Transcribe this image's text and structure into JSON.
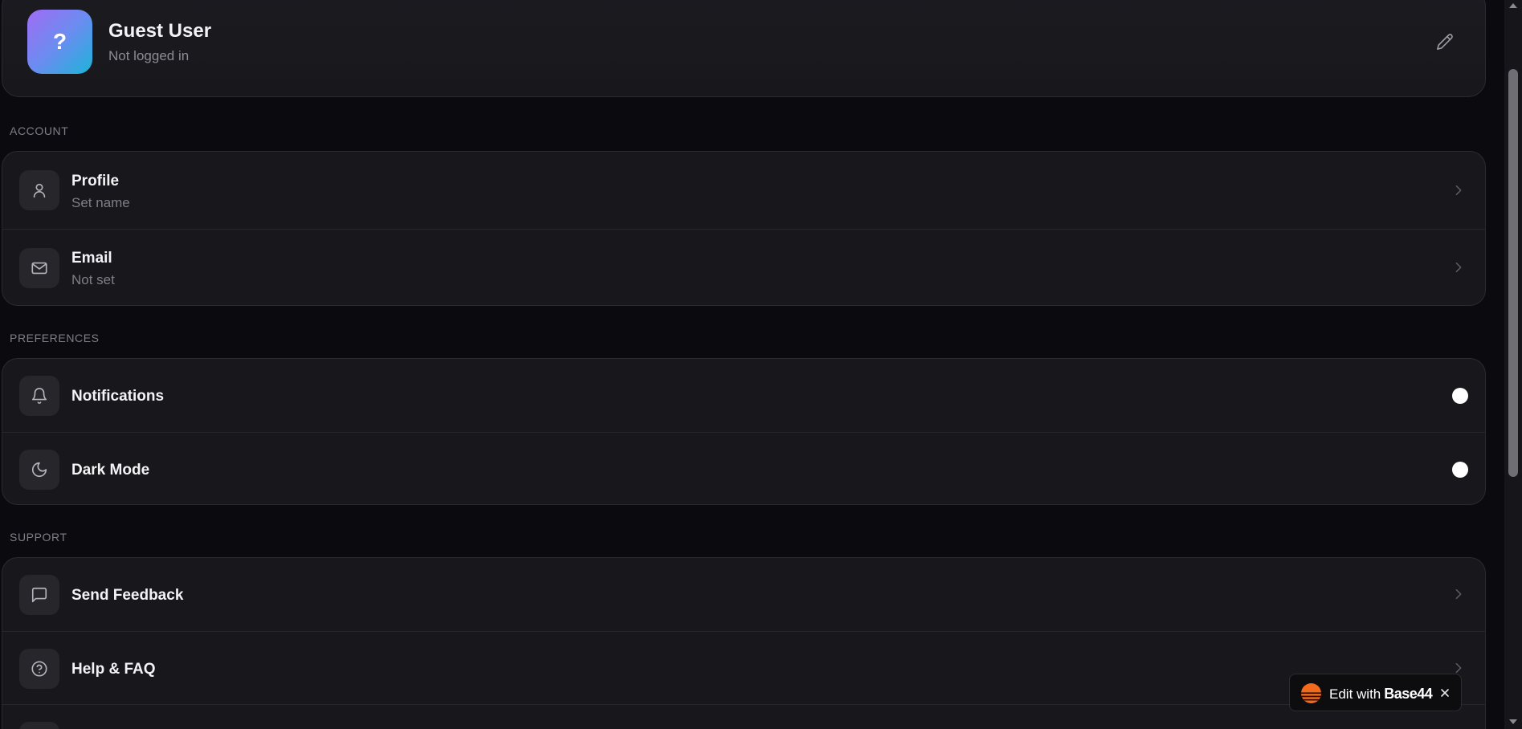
{
  "profile": {
    "avatar_glyph": "?",
    "name": "Guest User",
    "status": "Not logged in",
    "edit_icon": "pencil-icon"
  },
  "sections": {
    "account": {
      "label": "ACCOUNT",
      "items": [
        {
          "title": "Profile",
          "subtitle": "Set name",
          "icon": "user-icon"
        },
        {
          "title": "Email",
          "subtitle": "Not set",
          "icon": "mail-icon"
        }
      ]
    },
    "preferences": {
      "label": "PREFERENCES",
      "items": [
        {
          "title": "Notifications",
          "icon": "bell-icon"
        },
        {
          "title": "Dark Mode",
          "icon": "moon-icon"
        }
      ]
    },
    "support": {
      "label": "SUPPORT",
      "items": [
        {
          "title": "Send Feedback",
          "icon": "message-square-icon"
        },
        {
          "title": "Help & FAQ",
          "icon": "help-circle-icon"
        }
      ]
    }
  },
  "badge": {
    "prefix": "Edit with",
    "brand": "Base44"
  },
  "colors": {
    "background": "#0b0b0f",
    "card": "#18181c",
    "border": "#2a2a30",
    "muted_text": "#7e7e88",
    "avatar_gradient_start": "#a06cf5",
    "avatar_gradient_end": "#1cb4d8",
    "badge_logo": "#f26a1b"
  }
}
